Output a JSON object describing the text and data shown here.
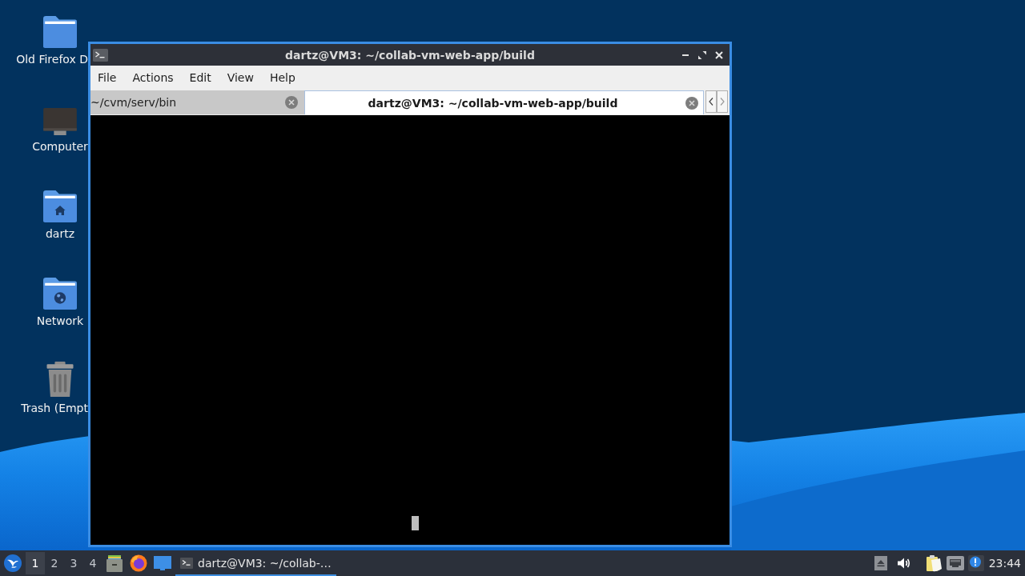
{
  "desktop_icons": [
    {
      "label": "Old Firefox D",
      "kind": "folder"
    },
    {
      "label": "Computer",
      "kind": "computer"
    },
    {
      "label": "dartz",
      "kind": "home"
    },
    {
      "label": "Network",
      "kind": "network"
    },
    {
      "label": "Trash (Empt",
      "kind": "trash"
    }
  ],
  "window": {
    "title": "dartz@VM3: ~/collab-vm-web-app/build",
    "menu": [
      "File",
      "Actions",
      "Edit",
      "View",
      "Help"
    ],
    "tabs": [
      {
        "label": "~/cvm/serv/bin",
        "selected": false
      },
      {
        "label": "dartz@VM3: ~/collab-vm-web-app/build",
        "selected": true
      }
    ]
  },
  "taskbar": {
    "workspaces": [
      {
        "label": "1",
        "selected": true
      },
      {
        "label": "2",
        "selected": false
      },
      {
        "label": "3",
        "selected": false
      },
      {
        "label": "4",
        "selected": false
      }
    ],
    "tasks": [
      {
        "label": "dartz@VM3: ~/collab-…",
        "selected": true
      }
    ],
    "clock": "23:44"
  }
}
